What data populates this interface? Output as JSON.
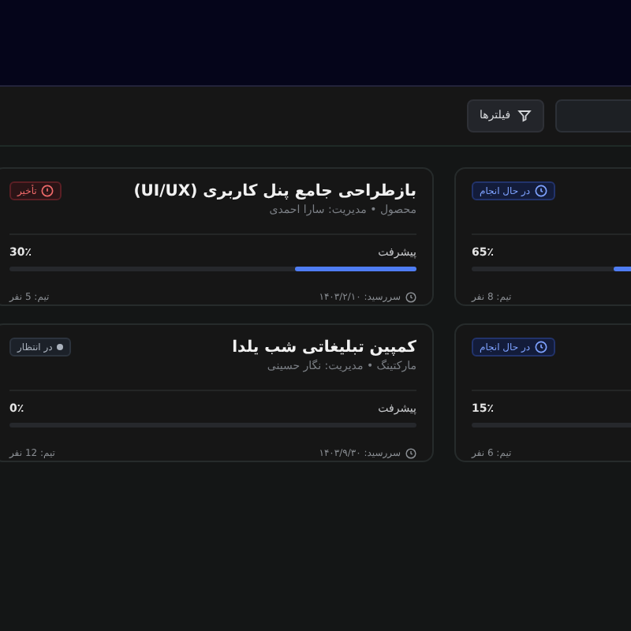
{
  "toolbar": {
    "filter_button": "فیلترها"
  },
  "projects": [
    {
      "status": {
        "kind": "active",
        "label": "در حال انجام"
      },
      "percent": "65٪",
      "level": 0.65,
      "team": "تیم: 8 نفر"
    },
    {
      "title": "بازطراحی جامع پنل کاربری (UI/UX)",
      "subtitle": "محصول • مدیریت: سارا احمدی",
      "status": {
        "kind": "late",
        "label": "تأخیر"
      },
      "progress_label": "پیشرفت",
      "percent": "30٪",
      "level": 0.3,
      "deadline": "سررسید: ۱۴۰۳/۲/۱۰",
      "team": "تیم: 5 نفر"
    },
    {
      "status": {
        "kind": "active",
        "label": "در حال انجام"
      },
      "percent": "15٪",
      "team": "تیم: 6 نفر"
    },
    {
      "title": "کمپین تبلیغاتی شب یلدا",
      "subtitle": "مارکتینگ • مدیریت: نگار حسینی",
      "status": {
        "kind": "pending",
        "label": "در انتظار"
      },
      "progress_label": "پیشرفت",
      "percent": "0٪",
      "level": 0,
      "deadline": "سررسید: ۱۴۰۳/۹/۳۰",
      "team": "تیم: 12 نفر"
    }
  ]
}
